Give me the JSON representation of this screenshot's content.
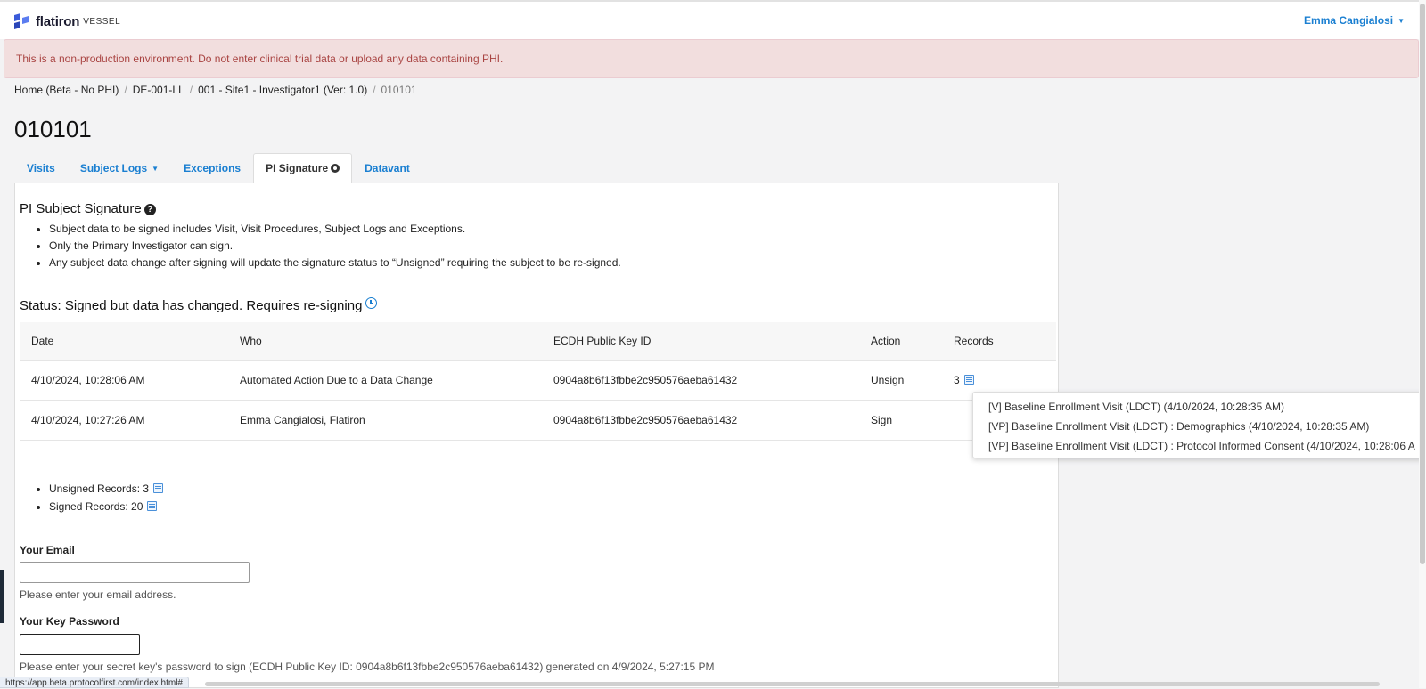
{
  "app": {
    "logo_text": "flatiron",
    "logo_sub": "VESSEL",
    "user_name": "Emma Cangialosi"
  },
  "alert": {
    "text": "This is a non-production environment. Do not enter clinical trial data or upload any data containing PHI."
  },
  "breadcrumb": {
    "items": [
      "Home (Beta - No PHI)",
      "DE-001-LL",
      "001 - Site1 - Investigator1 (Ver: 1.0)"
    ],
    "current": "010101",
    "separator": "/"
  },
  "page": {
    "title": "010101"
  },
  "tabs": [
    {
      "label": "Visits"
    },
    {
      "label": "Subject Logs"
    },
    {
      "label": "Exceptions"
    },
    {
      "label": "PI Signature"
    },
    {
      "label": "Datavant"
    }
  ],
  "signature": {
    "section_title": "PI Subject Signature",
    "bullets": [
      "Subject data to be signed includes Visit, Visit Procedures, Subject Logs and Exceptions.",
      "Only the Primary Investigator can sign.",
      "Any subject data change after signing will update the signature status to “Unsigned” requiring the subject to be re-signed."
    ],
    "status": "Status: Signed but data has changed. Requires re-signing"
  },
  "table": {
    "headers": [
      "Date",
      "Who",
      "ECDH Public Key ID",
      "Action",
      "Records"
    ],
    "rows": [
      {
        "date": "4/10/2024, 10:28:06 AM",
        "who": "Automated Action Due to a Data Change",
        "key": "0904a8b6f13fbbe2c950576aeba61432",
        "action": "Unsign",
        "records": "3"
      },
      {
        "date": "4/10/2024, 10:27:26 AM",
        "who": "Emma Cangialosi, Flatiron",
        "key": "0904a8b6f13fbbe2c950576aeba61432",
        "action": "Sign",
        "records": ""
      }
    ]
  },
  "popover": {
    "items": [
      "[V] Baseline Enrollment Visit (LDCT) (4/10/2024, 10:28:35 AM)",
      "[VP] Baseline Enrollment Visit (LDCT) : Demographics (4/10/2024, 10:28:35 AM)",
      "[VP] Baseline Enrollment Visit (LDCT) : Protocol Informed Consent (4/10/2024, 10:28:06 A"
    ]
  },
  "summary": {
    "unsigned_label": "Unsigned Records: 3",
    "signed_label": "Signed Records: 20"
  },
  "form": {
    "email_label": "Your Email",
    "email_value": "",
    "email_help": "Please enter your email address.",
    "password_label": "Your Key Password",
    "password_value": "",
    "password_help": "Please enter your secret key's password to sign (ECDH Public Key ID: 0904a8b6f13fbbe2c950576aeba61432) generated on 4/9/2024, 5:27:15 PM"
  },
  "statusbar": {
    "url": "https://app.beta.protocolfirst.com/index.html#"
  },
  "colors": {
    "link": "#1a7fd1",
    "alert_bg": "#f2dede",
    "alert_text": "#a94442",
    "page_bg": "#f3f3f4"
  }
}
